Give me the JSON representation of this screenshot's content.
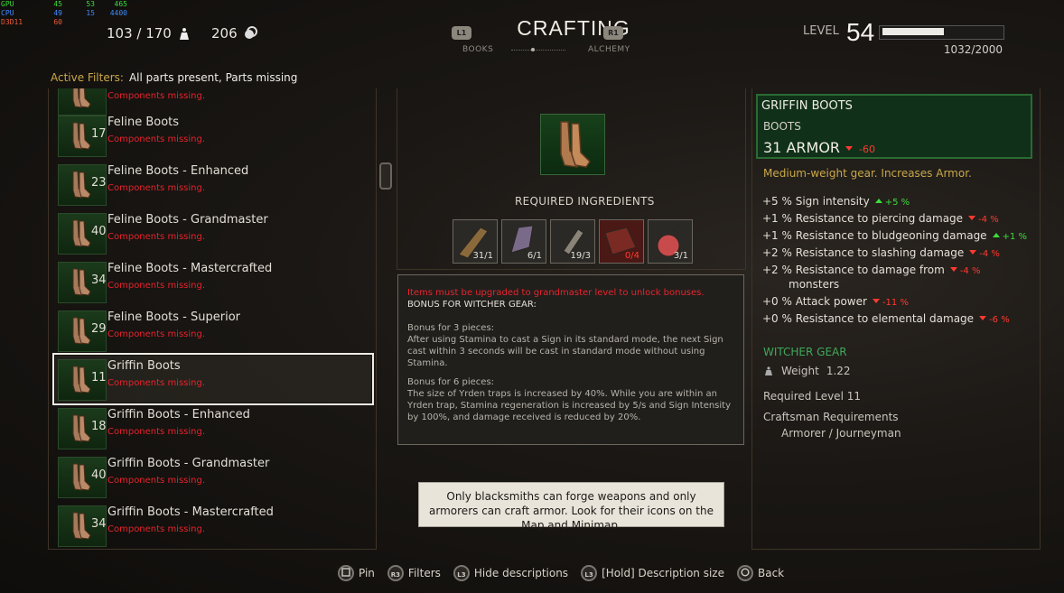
{
  "osd": {
    "rows": [
      {
        "k": "GPU",
        "a": "45",
        "b": "53",
        "c": "465",
        "color": "#3cdc3c"
      },
      {
        "k": "CPU",
        "a": "49",
        "b": "15",
        "c": "4400",
        "color": "#3c8cff"
      },
      {
        "k": "D3D11",
        "a": "60",
        "b": "",
        "c": "",
        "color": "#e85a3c"
      }
    ]
  },
  "stats": {
    "weight": "103 / 170",
    "crowns": "206"
  },
  "header": {
    "title": "CRAFTING",
    "left_btn": "L1",
    "right_btn": "R1",
    "left_tab": "BOOKS",
    "right_tab": "ALCHEMY"
  },
  "level": {
    "label": "LEVEL",
    "value": "54",
    "xp": "1032/2000",
    "progress": 0.516
  },
  "filters": {
    "label": "Active Filters:",
    "value": "All parts present, Parts missing"
  },
  "list": {
    "top_partial_status": "Components missing.",
    "items": [
      {
        "level": "17",
        "name": "Feline Boots",
        "status": "Components missing."
      },
      {
        "level": "23",
        "name": "Feline Boots - Enhanced",
        "status": "Components missing."
      },
      {
        "level": "40",
        "name": "Feline Boots - Grandmaster",
        "status": "Components missing."
      },
      {
        "level": "34",
        "name": "Feline Boots - Mastercrafted",
        "status": "Components missing."
      },
      {
        "level": "29",
        "name": "Feline Boots - Superior",
        "status": "Components missing."
      },
      {
        "level": "11",
        "name": "Griffin Boots",
        "status": "Components missing.",
        "selected": true
      },
      {
        "level": "18",
        "name": "Griffin Boots - Enhanced",
        "status": "Components missing."
      },
      {
        "level": "40",
        "name": "Griffin Boots - Grandmaster",
        "status": "Components missing."
      },
      {
        "level": "34",
        "name": "Griffin Boots - Mastercrafted",
        "status": "Components missing."
      }
    ]
  },
  "middle": {
    "ingredients_title": "REQUIRED INGREDIENTS",
    "ingredients": [
      {
        "count": "31/1",
        "icon": "leather-strap-icon",
        "missing": false
      },
      {
        "count": "6/1",
        "icon": "crystal-shard-icon",
        "missing": false
      },
      {
        "count": "19/3",
        "icon": "thread-spool-icon",
        "missing": false
      },
      {
        "count": "0/4",
        "icon": "leather-squares-icon",
        "missing": true
      },
      {
        "count": "3/1",
        "icon": "potion-flask-icon",
        "missing": false
      }
    ],
    "warning": "Items must be upgraded to grandmaster level to unlock bonuses.",
    "bonus_heading": "BONUS FOR WITCHER GEAR:",
    "bonus3_title": "Bonus for 3 pieces:",
    "bonus3_text": "After using Stamina to cast a Sign in its standard mode, the next Sign cast within 3 seconds will be cast in standard mode without using Stamina.",
    "bonus6_title": "Bonus for 6 pieces:",
    "bonus6_text": "The size of Yrden traps is increased by 40%. While you are within an Yrden trap, Stamina regeneration is increased by 5/s and Sign Intensity by 100%, and damage received is reduced by 20%."
  },
  "tooltip": "Only blacksmiths can forge weapons and only armorers can craft armor. Look for their icons on the Map and Minimap.",
  "item": {
    "name": "GRIFFIN BOOTS",
    "type": "BOOTS",
    "armor": "31 ARMOR",
    "armor_delta": "-60",
    "description": "Medium-weight gear. Increases Armor.",
    "stats": [
      {
        "text": "+5 % Sign intensity",
        "delta": "+5 %",
        "dir": "up"
      },
      {
        "text": "+1 % Resistance to piercing damage",
        "delta": "-4 %",
        "dir": "down"
      },
      {
        "text": "+1 % Resistance to bludgeoning damage",
        "delta": "+1 %",
        "dir": "up"
      },
      {
        "text": "+2 % Resistance to slashing damage",
        "delta": "-4 %",
        "dir": "down"
      },
      {
        "text": "+2 % Resistance to damage from",
        "delta": "-4 %",
        "dir": "down",
        "cont": "monsters"
      },
      {
        "text": "+0 % Attack power",
        "delta": "-11 %",
        "dir": "down"
      },
      {
        "text": "+0 % Resistance to elemental damage",
        "delta": "-6 %",
        "dir": "down"
      }
    ],
    "gear": "WITCHER GEAR",
    "weight_label": "Weight",
    "weight": "1.22",
    "required_level": "Required Level 11",
    "craftsman_label": "Craftsman Requirements",
    "craftsman": "Armorer / Journeyman"
  },
  "bottom": [
    {
      "btn": "",
      "label": "Pin",
      "shape": "square"
    },
    {
      "btn": "R3",
      "label": "Filters"
    },
    {
      "btn": "L3",
      "label": "Hide descriptions"
    },
    {
      "btn": "L3",
      "label": "[Hold] Description size"
    },
    {
      "btn": "",
      "label": "Back",
      "shape": "circle"
    }
  ]
}
